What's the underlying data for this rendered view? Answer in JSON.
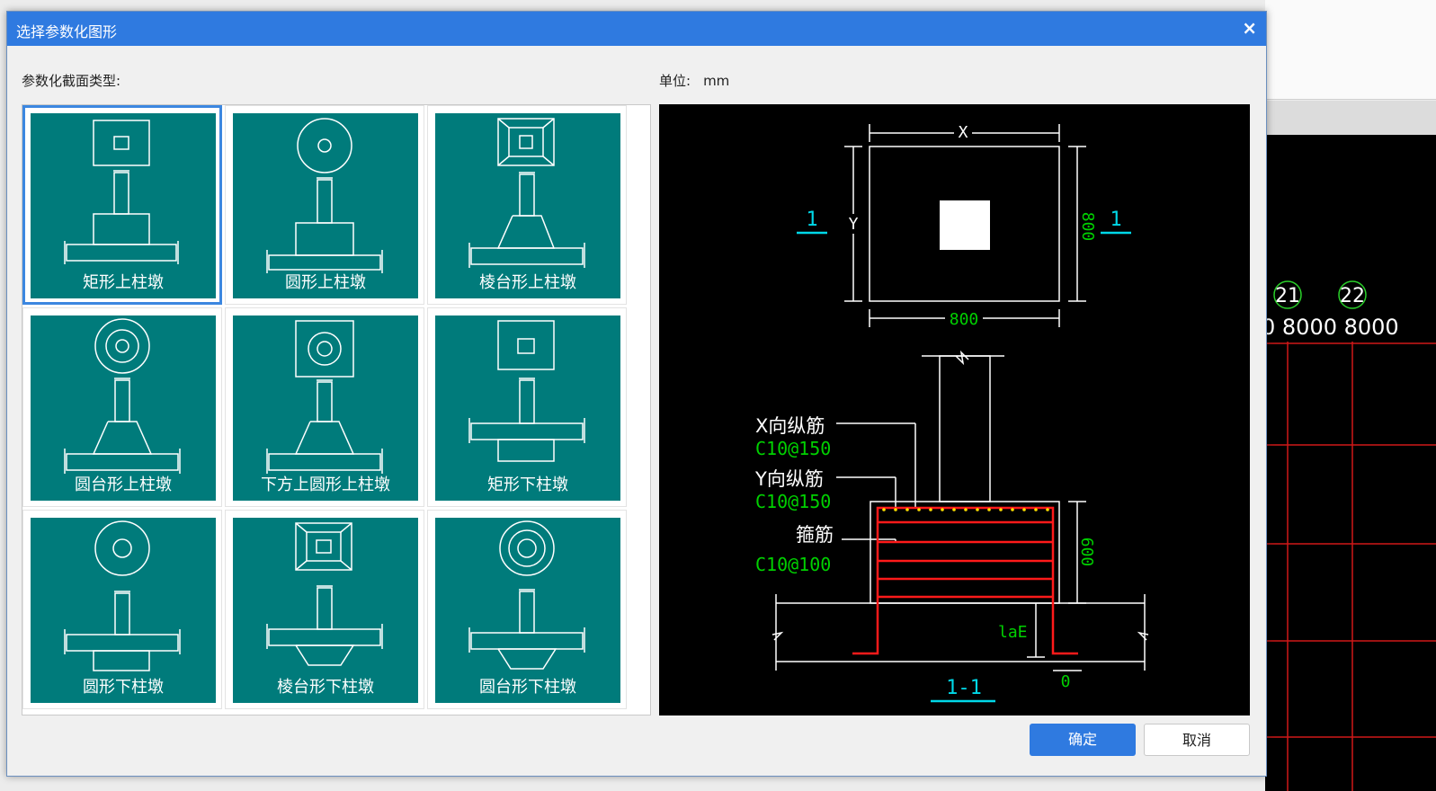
{
  "dialog": {
    "title": "选择参数化图形",
    "close_glyph": "×",
    "section_label": "参数化截面类型:",
    "unit_label": "单位:",
    "unit_value": "mm",
    "ok_label": "确定",
    "cancel_label": "取消"
  },
  "shapes": [
    {
      "label": "矩形上柱墩",
      "selected": true
    },
    {
      "label": "圆形上柱墩"
    },
    {
      "label": "棱台形上柱墩"
    },
    {
      "label": "圆台形上柱墩"
    },
    {
      "label": "下方上圆形上柱墩"
    },
    {
      "label": "矩形下柱墩"
    },
    {
      "label": "圆形下柱墩"
    },
    {
      "label": "棱台形下柱墩"
    },
    {
      "label": "圆台形下柱墩"
    }
  ],
  "preview": {
    "dim_x": "X",
    "dim_y": "Y",
    "dim_800_bottom": "800",
    "dim_800_right": "800",
    "section_mark": "1",
    "x_bar_label": "X向纵筋",
    "x_bar_value": "C10@150",
    "y_bar_label": "Y向纵筋",
    "y_bar_value": "C10@150",
    "stirrup_label": "箍筋",
    "stirrup_value": "C10@100",
    "dim_600": "600",
    "lae_label": "laE",
    "zero_label": "0",
    "section_title": "1-1"
  },
  "background": {
    "grid_numbers": [
      "21",
      "22"
    ],
    "grid_spans": "0 8000  8000"
  },
  "colors": {
    "title_bar": "#2f7ae0",
    "tile": "#007b7b",
    "selected_border": "#3c87e0",
    "rebar": "#ff1a1a",
    "label_green": "#00d000",
    "cyan": "#00d8e8"
  }
}
